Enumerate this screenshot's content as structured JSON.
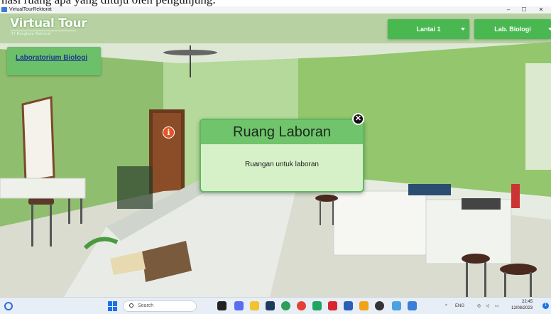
{
  "caption": "nasi ruang apa yang dituju oleh pengunjung.",
  "window": {
    "title": "VirtualTourRektorat",
    "minimize": "–",
    "maximize": "☐",
    "close": "✕"
  },
  "app": {
    "logo": "Virtual Tour",
    "logo_sub": "IIT Bengkulu Rektorat",
    "floor_select": "Lantai 1",
    "room_select": "Lab. Biologi",
    "room_label": "Laboratorium Biologi",
    "hotspot_icon": "i"
  },
  "popup": {
    "title": "Ruang Laboran",
    "description": "Ruangan untuk laboran",
    "close_icon": "✕"
  },
  "taskbar": {
    "search_label": "Search",
    "lang": "ENG",
    "time": "22:45",
    "date": "12/08/2023",
    "notification_count": "1"
  },
  "colors": {
    "accent_green": "#49b850",
    "popup_header": "#6fc46c",
    "hotspot": "#e0552a"
  }
}
